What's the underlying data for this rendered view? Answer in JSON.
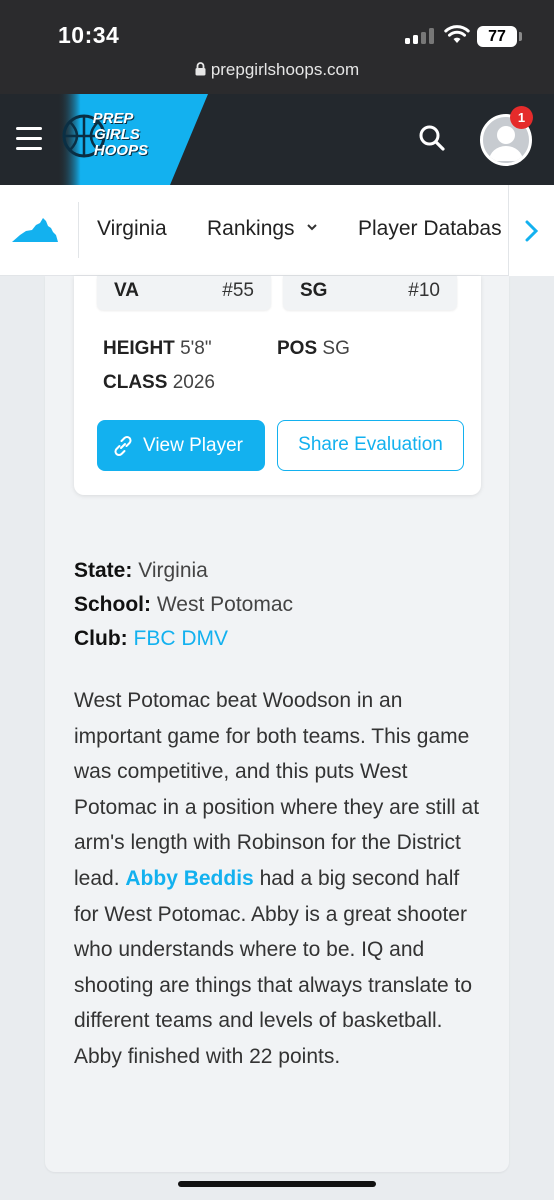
{
  "status_bar": {
    "time": "10:34",
    "battery": "77"
  },
  "browser": {
    "url": "prepgirlshoops.com"
  },
  "header": {
    "logo": {
      "line1": "PREP",
      "line2": "GIRLS",
      "line3": "HOOPS"
    },
    "notification_count": "1"
  },
  "subnav": {
    "items": [
      "Virginia",
      "Rankings",
      "Player Databas"
    ]
  },
  "player_card": {
    "state_abbr": "VA",
    "state_rank": "#55",
    "position_abbr": "SG",
    "position_rank": "#10",
    "height_label": "HEIGHT",
    "height_value": "5'8\"",
    "pos_label": "POS",
    "pos_value": "SG",
    "class_label": "CLASS",
    "class_value": "2026",
    "view_button": "View Player",
    "share_button": "Share Evaluation"
  },
  "details": {
    "state_label": "State:",
    "state_value": "Virginia",
    "school_label": "School:",
    "school_value": "West Potomac",
    "club_label": "Club:",
    "club_value": "FBC DMV"
  },
  "evaluation": {
    "text_before": "West Potomac beat Woodson in an important game for both teams. This game was competitive, and this puts West Potomac in a position where they are still at arm's length with Robinson for the District lead. ",
    "player_link": "Abby Beddis",
    "text_after": " had a big second half for West Potomac. Abby is a great shooter who understands where to be. IQ and shooting are things that always translate to different teams and levels of basketball. Abby finished with 22 points."
  },
  "colors": {
    "accent": "#13b1ef",
    "header_bg": "#23282d",
    "badge": "#e52b2b"
  }
}
